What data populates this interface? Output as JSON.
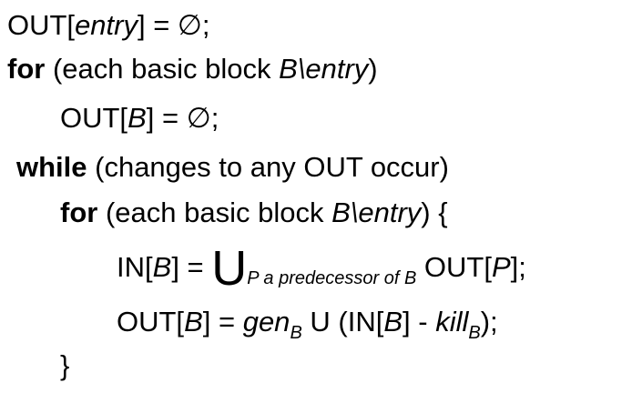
{
  "algorithm": {
    "l1": {
      "a": "OUT[",
      "b": "entry",
      "c": "] = ∅;"
    },
    "l2": {
      "kw": "for",
      "a": " (each basic block ",
      "b": "B\\entry",
      "c": ")"
    },
    "l3": {
      "a": "OUT[",
      "b": "B",
      "c": "] = ∅;"
    },
    "l4": {
      "kw": "while",
      "a": " (changes to any OUT occur)"
    },
    "l5": {
      "kw": "for",
      "a": " (each basic block ",
      "b": "B\\entry",
      "c": ") {"
    },
    "l6": {
      "a": "IN[",
      "b": "B",
      "c": "] = ",
      "union": "U",
      "sub": "P a predecessor of B",
      "d": " OUT[",
      "e": "P",
      "f": "];"
    },
    "l7": {
      "a": "OUT[",
      "b": "B",
      "c": "] = ",
      "gen": "gen",
      "gen_sub": "B",
      "d": " U (IN[",
      "e": "B",
      "f": "] - ",
      "kill": "kill",
      "kill_sub": "B",
      "g": ");"
    },
    "l8": {
      "a": "}"
    }
  }
}
